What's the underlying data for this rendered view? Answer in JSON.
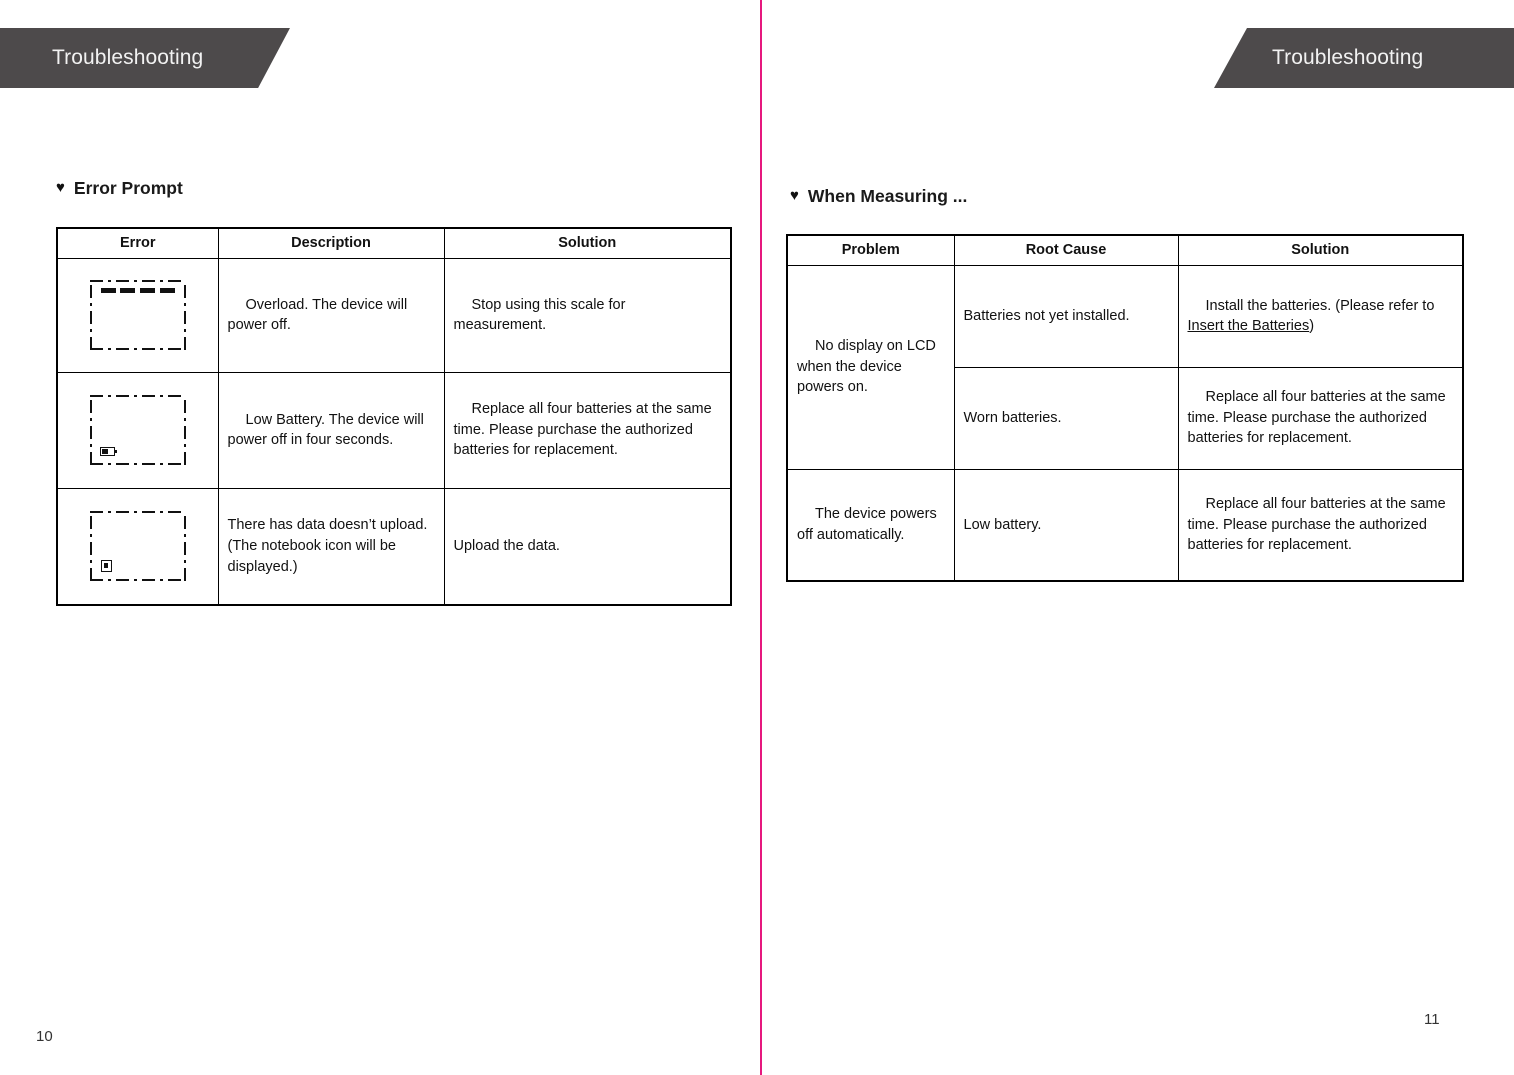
{
  "spread": {
    "divider_color": "#e6187e",
    "banner_color": "#4d4a4b"
  },
  "left_page": {
    "banner_title": "Troubleshooting",
    "folio": "10",
    "section": {
      "heading": "Error Prompt",
      "bullet_icon": "heart-icon"
    },
    "table": {
      "headers": [
        "Error",
        "Description",
        "Solution"
      ],
      "rows": [
        {
          "icon": "lcd-overload-icon",
          "description": "Overload. The device will power off.",
          "solution": "Stop using this scale for measurement."
        },
        {
          "icon": "lcd-low-battery-icon",
          "description": "Low Battery. The device will power off in four seconds.",
          "solution": "Replace all four batteries at the same time. Please purchase the authorized batteries for replacement."
        },
        {
          "icon": "lcd-notebook-icon",
          "description": "There has data doesn’t upload. (The notebook icon will be displayed.)",
          "solution": "Upload the data."
        }
      ]
    }
  },
  "right_page": {
    "banner_title": "Troubleshooting",
    "folio": "11",
    "section": {
      "heading": "When Measuring ...",
      "bullet_icon": "heart-icon"
    },
    "table": {
      "headers": [
        "Problem",
        "Root Cause",
        "Solution"
      ],
      "rows": [
        {
          "problem": "No display on LCD when the device powers on.",
          "root_cause": "Batteries not yet installed.",
          "solution_prefix": "Install the batteries. (Please refer to ",
          "solution_link": "Insert the Batteries",
          "solution_suffix": ")"
        },
        {
          "root_cause": "Worn batteries.",
          "solution": "Replace all four batteries at the same time. Please purchase the authorized batteries for replacement."
        },
        {
          "problem": "The device powers off automatically.",
          "root_cause": "Low battery.",
          "solution": "Replace all four batteries at the same time. Please purchase the authorized batteries for replacement."
        }
      ]
    }
  }
}
